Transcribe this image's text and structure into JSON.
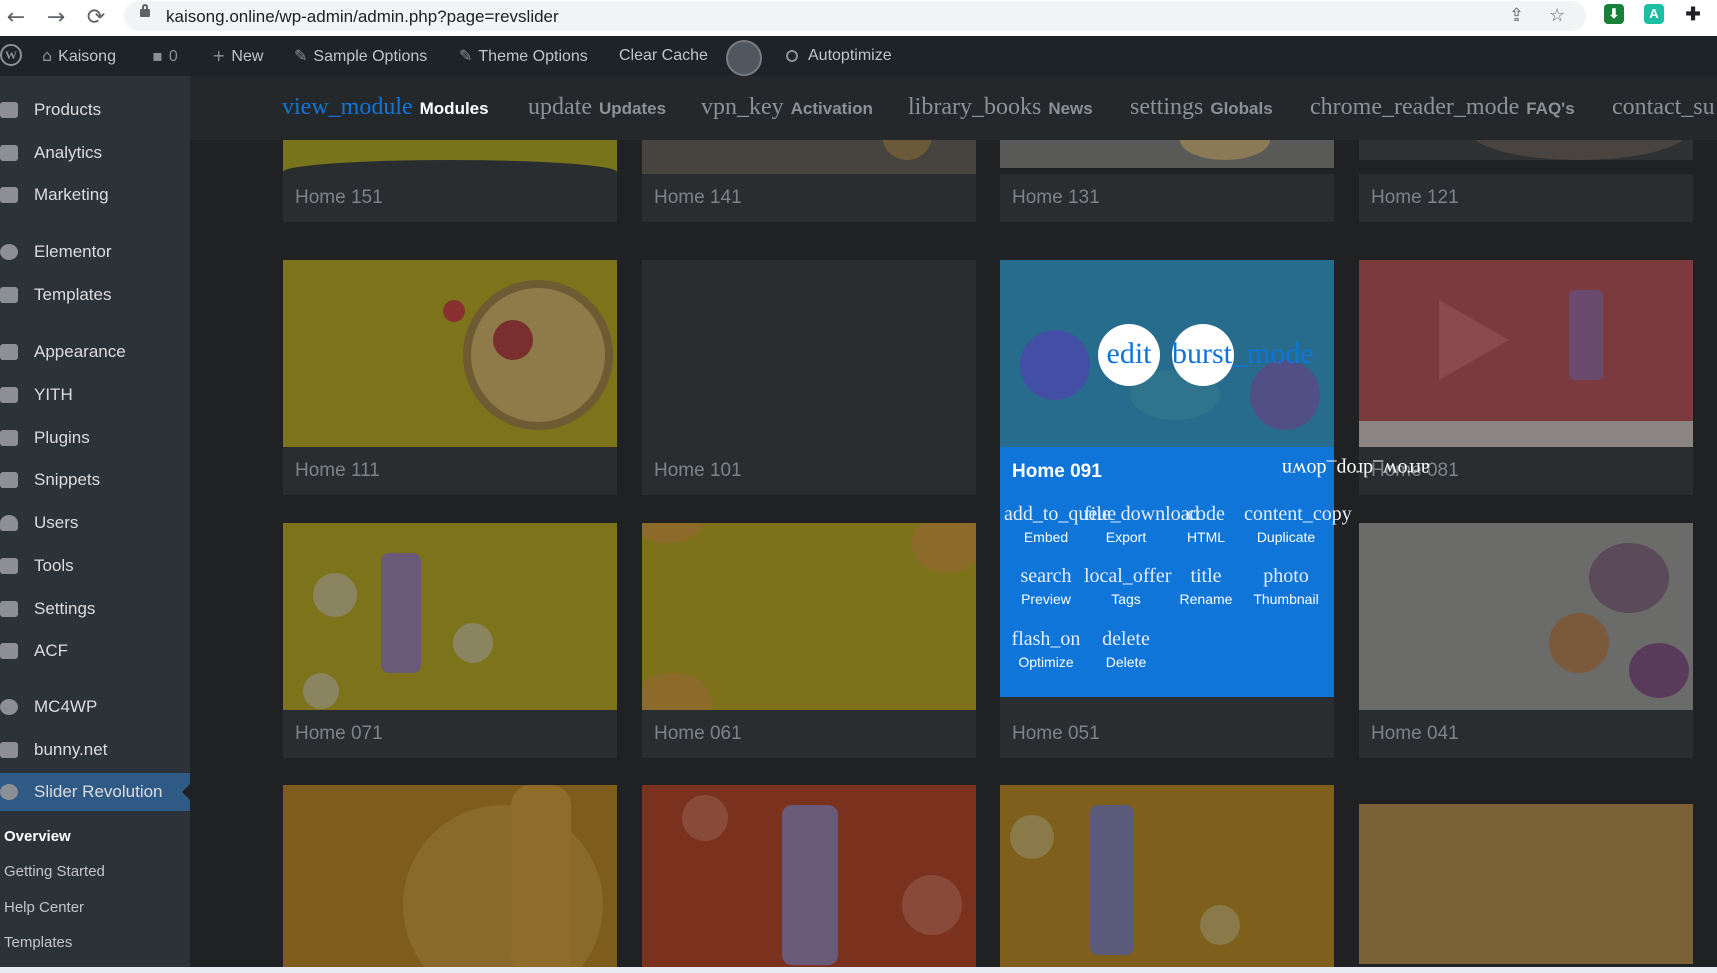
{
  "browser": {
    "url": "kaisong.online/wp-admin/admin.php?page=revslider",
    "back_icon": "arrow-left-icon",
    "forward_icon": "arrow-right-icon",
    "reload_icon": "reload-icon"
  },
  "admin_bar": {
    "site": "Kaisong",
    "comments": "0",
    "new": "New",
    "sample_options": "Sample Options",
    "theme_options": "Theme Options",
    "clear_cache": "Clear Cache",
    "autoptimize": "Autoptimize"
  },
  "sidebar": {
    "items": [
      {
        "label": "Products",
        "icon": "products-icon"
      },
      {
        "label": "Analytics",
        "icon": "analytics-icon"
      },
      {
        "label": "Marketing",
        "icon": "megaphone-icon"
      },
      {
        "label": "Elementor",
        "icon": "elementor-icon"
      },
      {
        "label": "Templates",
        "icon": "folder-icon"
      },
      {
        "label": "Appearance",
        "icon": "paintbrush-icon"
      },
      {
        "label": "YITH",
        "icon": "yith-icon"
      },
      {
        "label": "Plugins",
        "icon": "plugin-icon"
      },
      {
        "label": "Snippets",
        "icon": "scissors-icon"
      },
      {
        "label": "Users",
        "icon": "user-icon"
      },
      {
        "label": "Tools",
        "icon": "wrench-icon"
      },
      {
        "label": "Settings",
        "icon": "settings-icon"
      },
      {
        "label": "ACF",
        "icon": "acf-icon"
      },
      {
        "label": "MC4WP",
        "icon": "mc4wp-icon"
      },
      {
        "label": "bunny.net",
        "icon": "bunny-icon"
      },
      {
        "label": "Slider Revolution",
        "icon": "slider-revolution-icon"
      }
    ],
    "submenu": [
      "Overview",
      "Getting Started",
      "Help Center",
      "Templates"
    ]
  },
  "rs_nav": {
    "tabs": [
      {
        "icon": "view_module",
        "label": "Modules"
      },
      {
        "icon": "update",
        "label": "Updates"
      },
      {
        "icon": "vpn_key",
        "label": "Activation"
      },
      {
        "icon": "library_books",
        "label": "News"
      },
      {
        "icon": "settings",
        "label": "Globals"
      },
      {
        "icon": "chrome_reader_mode",
        "label": "FAQ's"
      },
      {
        "icon": "contact_su",
        "label": ""
      }
    ]
  },
  "cards": [
    "Home 151",
    "Home 141",
    "Home 131",
    "Home 121",
    "Home 111",
    "Home 101",
    "Home 091",
    "Home 081",
    "Home 071",
    "Home 061",
    "Home 051",
    "Home 041"
  ],
  "active_card": {
    "title": "Home 091",
    "round_buttons": [
      "edit",
      "burst_mode"
    ],
    "flipped_icon": "arrow_drop_down",
    "actions": [
      {
        "icon": "add_to_queue",
        "label": "Embed"
      },
      {
        "icon": "file_download",
        "label": "Export"
      },
      {
        "icon": "code",
        "label": "HTML"
      },
      {
        "icon": "content_copy",
        "label": "Duplicate"
      },
      {
        "icon": "search",
        "label": "Preview"
      },
      {
        "icon": "local_offer",
        "label": "Tags"
      },
      {
        "icon": "title",
        "label": "Rename"
      },
      {
        "icon": "photo",
        "label": "Thumbnail"
      },
      {
        "icon": "flash_on",
        "label": "Optimize"
      },
      {
        "icon": "delete",
        "label": "Delete"
      }
    ]
  }
}
